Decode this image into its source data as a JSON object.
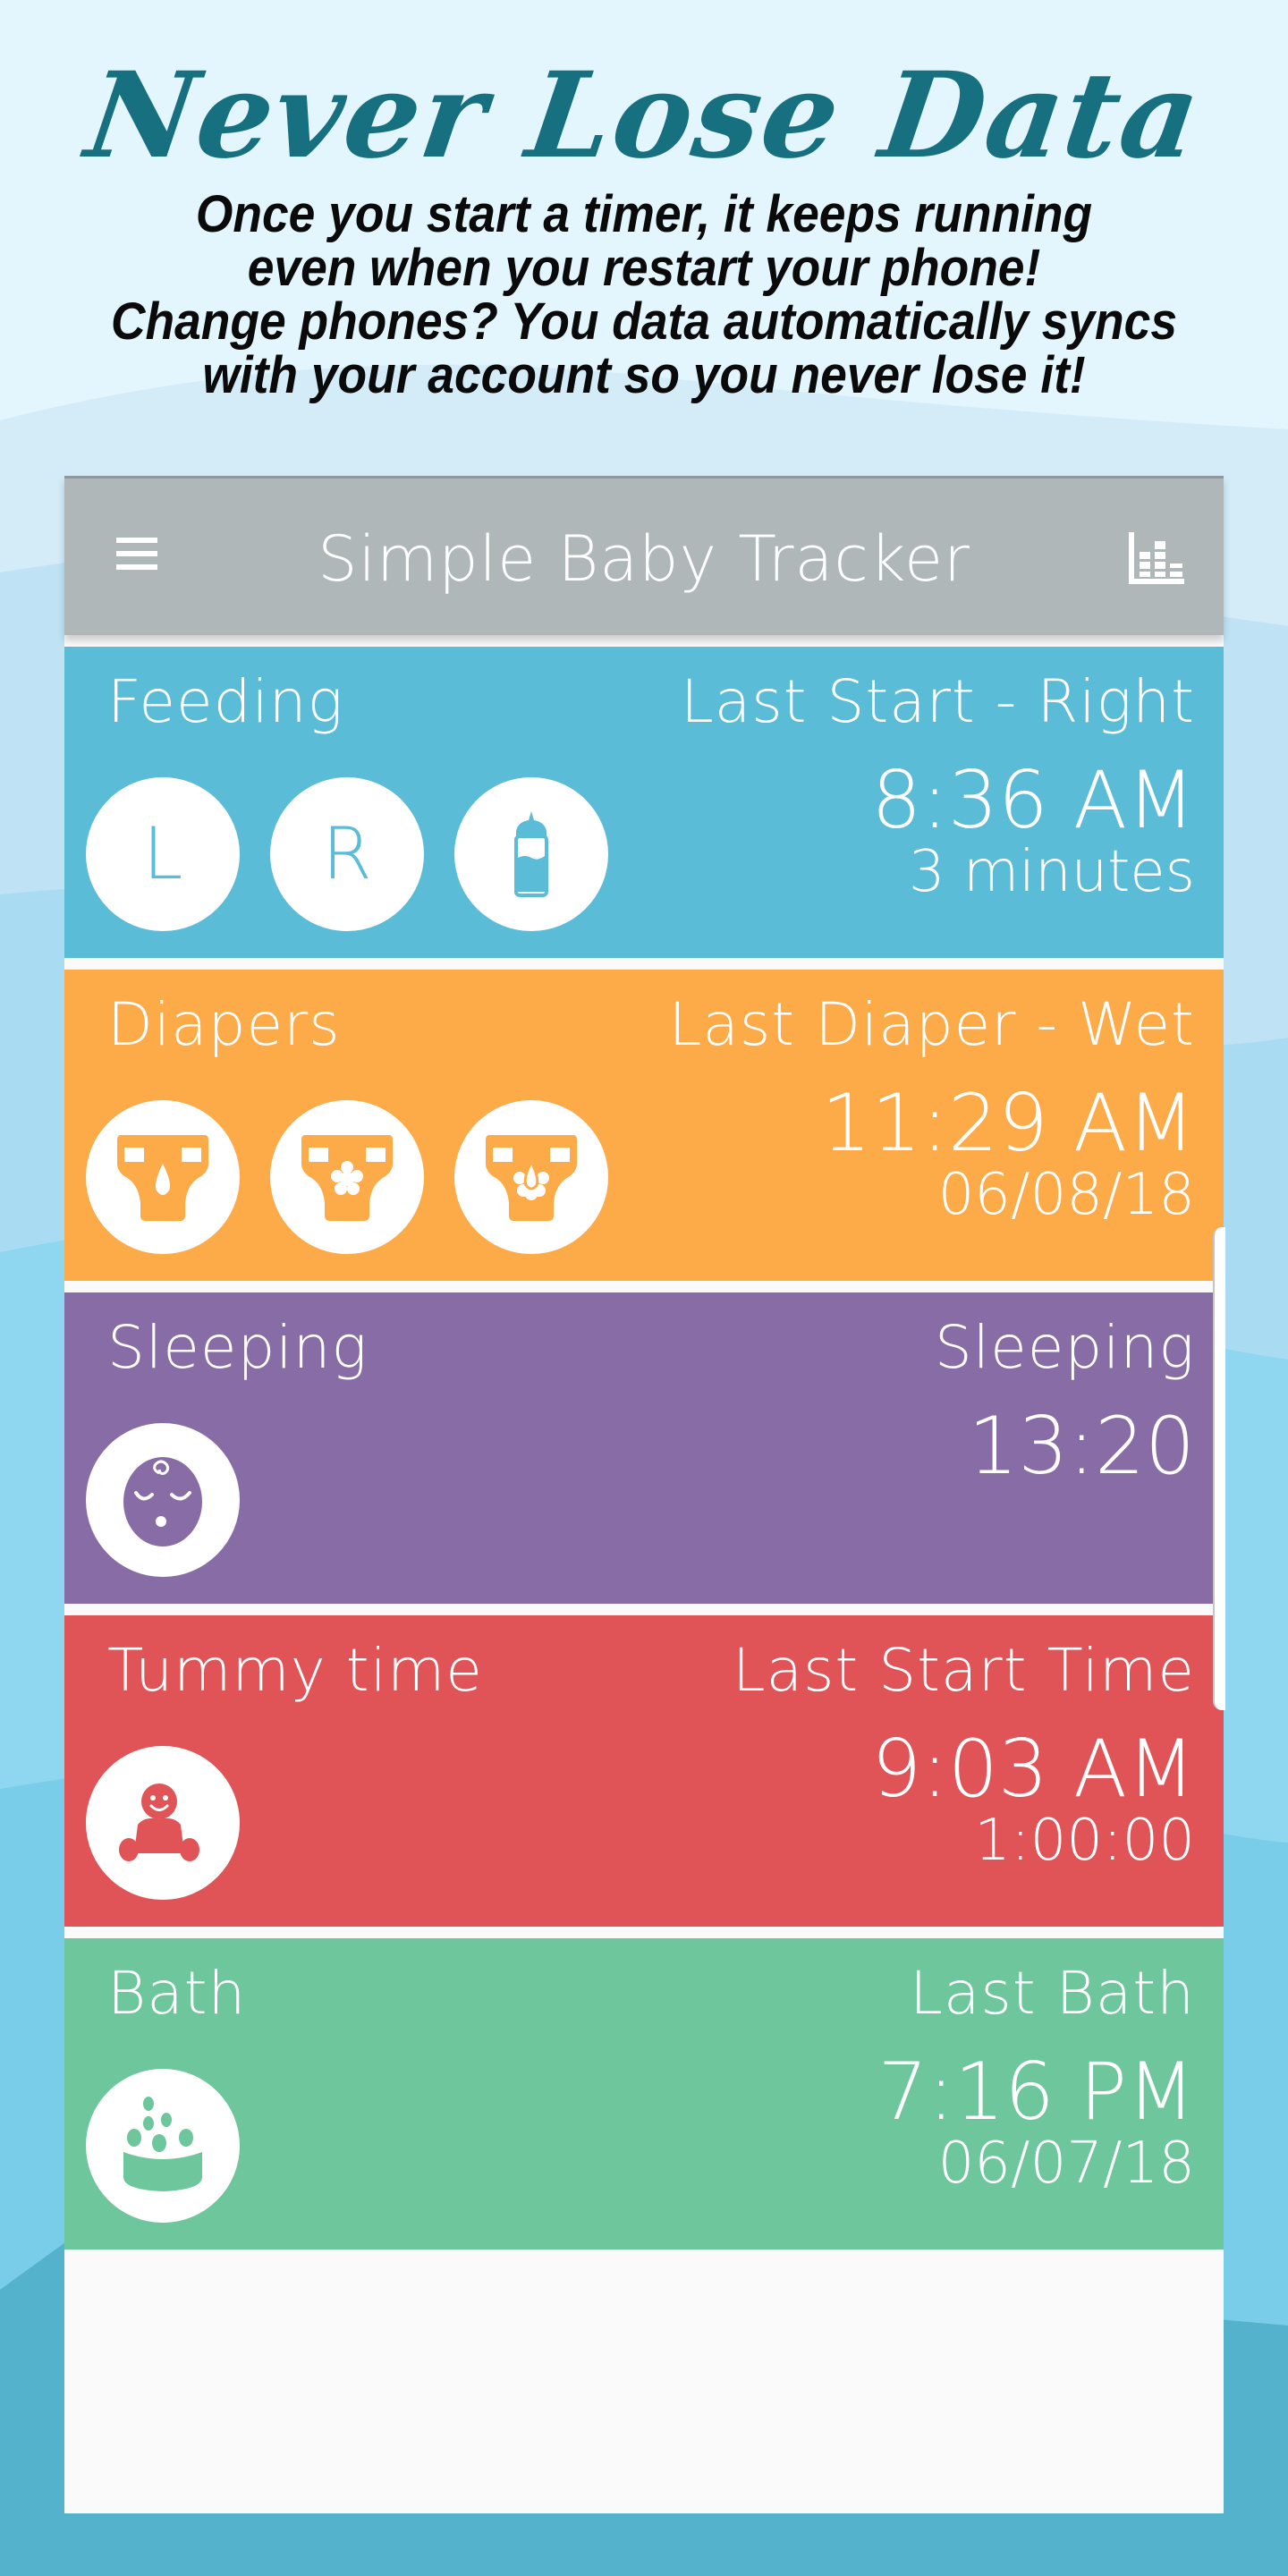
{
  "promo": {
    "headline": "Never Lose Data",
    "body_lines": [
      "Once you start a timer, it keeps running",
      "even when you restart your phone!",
      "Change phones? You data automatically syncs",
      "with your account so you never lose it!"
    ]
  },
  "app": {
    "title": "Simple Baby Tracker",
    "menu_icon": "hamburger-menu-icon",
    "stats_icon": "bar-chart-icon"
  },
  "colors": {
    "feeding": "#5abcd7",
    "diapers": "#fdaa48",
    "sleeping": "#876ca6",
    "tummy_time": "#e05357",
    "bath": "#6dc69c",
    "appbar": "#afb7b9",
    "headline": "#16707f"
  },
  "cards": {
    "feeding": {
      "title": "Feeding",
      "status_label": "Last Start - Right",
      "time": "8:36 AM",
      "sub": "3 minutes",
      "buttons": [
        {
          "label": "L",
          "icon": "left-breast-letter"
        },
        {
          "label": "R",
          "icon": "right-breast-letter"
        },
        {
          "label": "",
          "icon": "baby-bottle-icon"
        }
      ]
    },
    "diapers": {
      "title": "Diapers",
      "status_label": "Last Diaper - Wet",
      "time": "11:29 AM",
      "sub": "06/08/18",
      "buttons": [
        {
          "icon": "wet-diaper-icon"
        },
        {
          "icon": "dirty-diaper-icon"
        },
        {
          "icon": "mixed-diaper-icon"
        }
      ]
    },
    "sleeping": {
      "title": "Sleeping",
      "status_label": "Sleeping",
      "time": "13:20",
      "buttons": [
        {
          "icon": "sleeping-baby-icon"
        }
      ]
    },
    "tummy_time": {
      "title": "Tummy time",
      "status_label": "Last Start Time",
      "time": "9:03 AM",
      "sub": "1:00:00",
      "buttons": [
        {
          "icon": "tummy-time-baby-icon"
        }
      ]
    },
    "bath": {
      "title": "Bath",
      "status_label": "Last Bath",
      "time": "7:16 PM",
      "sub": "06/07/18",
      "buttons": [
        {
          "icon": "bathtub-bubbles-icon"
        }
      ]
    }
  }
}
